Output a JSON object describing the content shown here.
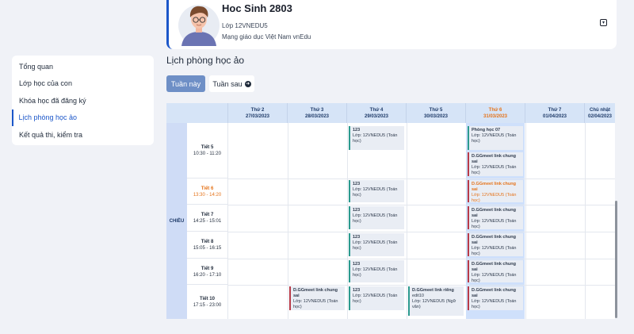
{
  "profile": {
    "name": "Hoc Sinh 2803",
    "class": "Lớp 12VNEDU5",
    "network": "Mạng giáo dục Việt Nam vnEdu",
    "toggle_icon": "chevron-down-icon"
  },
  "sidebar": {
    "items": [
      {
        "label": "Tổng quan"
      },
      {
        "label": "Lớp học của con"
      },
      {
        "label": "Khóa học đã đăng ký"
      },
      {
        "label": "Lịch phòng học ảo"
      },
      {
        "label": "Kết quả thi, kiểm tra"
      }
    ],
    "active_index": 3
  },
  "page": {
    "title": "Lịch phòng học ảo",
    "this_week": "Tuần này",
    "next_week": "Tuần sau"
  },
  "schedule": {
    "days": [
      {
        "name": "Thứ 2",
        "date": "27/03/2023"
      },
      {
        "name": "Thứ 3",
        "date": "28/03/2023"
      },
      {
        "name": "Thứ 4",
        "date": "29/03/2023"
      },
      {
        "name": "Thứ 5",
        "date": "30/03/2023"
      },
      {
        "name": "Thứ 6",
        "date": "31/03/2023"
      },
      {
        "name": "Thứ 7",
        "date": "01/04/2023"
      },
      {
        "name": "Chủ nhật",
        "date": "02/04/2023"
      }
    ],
    "today_index": 4,
    "session": "CHIỀU",
    "periods": [
      {
        "name": "Tiết 5",
        "time": "10:30 - 11:20"
      },
      {
        "name": "Tiết 6",
        "time": "13:30 - 14:20"
      },
      {
        "name": "Tiết 7",
        "time": "14:25 - 15:01"
      },
      {
        "name": "Tiết 8",
        "time": "15:05 - 16:15"
      },
      {
        "name": "Tiết 9",
        "time": "16:20 - 17:10"
      },
      {
        "name": "Tiết 10",
        "time": "17:15 - 23:00"
      }
    ],
    "cards": [
      {
        "title": "123",
        "line1": "Lớp: 12VNEDU5 (Toán",
        "line2": "học)"
      },
      {
        "title": "Phòng học 07",
        "line1": "Lớp: 12VNEDU5 (Toán",
        "line2": "học)"
      },
      {
        "title": "D.GGmeet link chung sai",
        "line1": "Lớp: 12VNEDU5 (Toán",
        "line2": "học)"
      },
      {
        "title": "D.GGmeet link riêng",
        "line1": "edit10",
        "line2": "Lớp: 12VNEDU5 (Ngữ",
        "line3": "văn)"
      }
    ]
  },
  "colors": {
    "accent": "#1b56c9",
    "today": "#e5731a",
    "header_bg": "#d6e4f7",
    "card_teal": "#2b9a8e",
    "card_red": "#b83a48"
  }
}
